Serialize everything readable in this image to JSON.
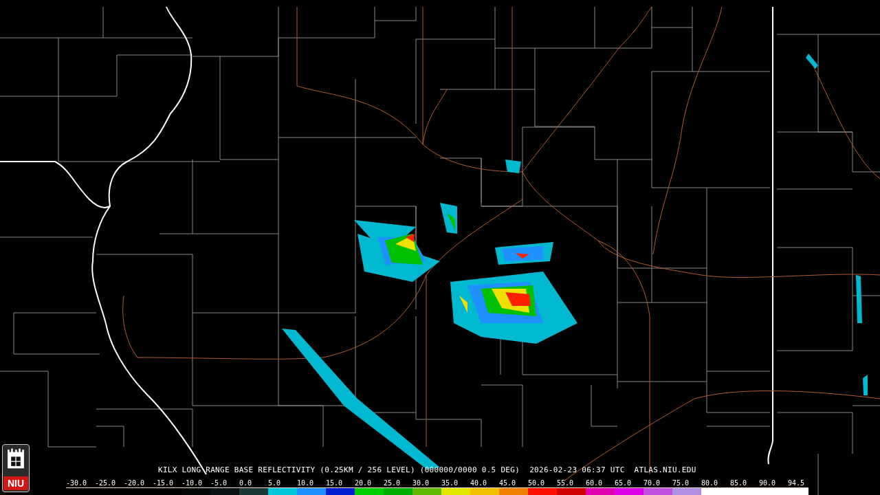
{
  "caption": {
    "product": "KILX LONG RANGE BASE REFLECTIVITY (0.25KM / 256 LEVEL) (000000/0000 0.5 DEG)",
    "timestamp": "2026-02-23 06:37 UTC",
    "site": "ATLAS.NIU.EDU"
  },
  "logo": {
    "text": "NIU"
  },
  "legend": [
    {
      "label": "-30.0",
      "color": "#000000"
    },
    {
      "label": "-25.0",
      "color": "#000000"
    },
    {
      "label": "-20.0",
      "color": "#000000"
    },
    {
      "label": "-15.0",
      "color": "#000000"
    },
    {
      "label": "-10.0",
      "color": "#050808"
    },
    {
      "label": "-5.0",
      "color": "#0a1414"
    },
    {
      "label": "0.0",
      "color": "#1a3a3a"
    },
    {
      "label": "5.0",
      "color": "#00c8d8"
    },
    {
      "label": "10.0",
      "color": "#1e90ff"
    },
    {
      "label": "15.0",
      "color": "#0020d0"
    },
    {
      "label": "20.0",
      "color": "#00d000"
    },
    {
      "label": "25.0",
      "color": "#00b000"
    },
    {
      "label": "30.0",
      "color": "#60b800"
    },
    {
      "label": "35.0",
      "color": "#e0e800"
    },
    {
      "label": "40.0",
      "color": "#f0c000"
    },
    {
      "label": "45.0",
      "color": "#f08000"
    },
    {
      "label": "50.0",
      "color": "#ff1000"
    },
    {
      "label": "55.0",
      "color": "#d00000"
    },
    {
      "label": "60.0",
      "color": "#e000b0"
    },
    {
      "label": "65.0",
      "color": "#e000e8"
    },
    {
      "label": "70.0",
      "color": "#c050e0"
    },
    {
      "label": "75.0",
      "color": "#b090e0"
    },
    {
      "label": "80.0",
      "color": "#ffffff"
    },
    {
      "label": "85.0",
      "color": "#ffffff"
    },
    {
      "label": "90.0",
      "color": "#ffffff"
    }
  ],
  "legend_end": {
    "label": "94.5",
    "color": "#ffffff"
  }
}
